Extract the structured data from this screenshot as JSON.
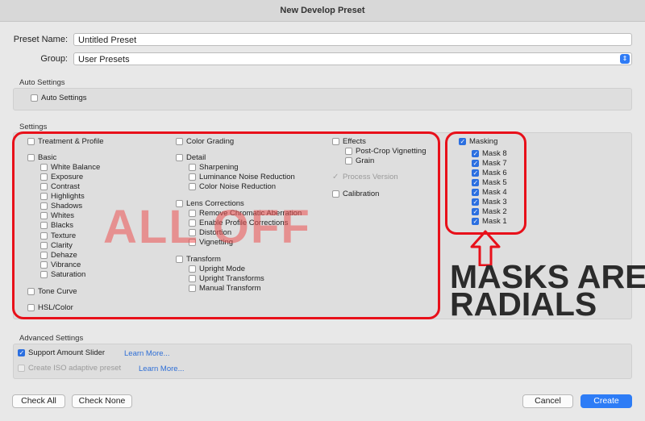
{
  "window": {
    "title": "New Develop Preset"
  },
  "preset_name": {
    "label": "Preset Name:",
    "value": "Untitled Preset"
  },
  "group": {
    "label": "Group:",
    "value": "User Presets"
  },
  "auto_settings": {
    "title": "Auto Settings",
    "checkbox_label": "Auto Settings"
  },
  "settings": {
    "title": "Settings",
    "col1": {
      "treatment": "Treatment & Profile",
      "basic": "Basic",
      "basic_items": [
        "White Balance",
        "Exposure",
        "Contrast",
        "Highlights",
        "Shadows",
        "Whites",
        "Blacks",
        "Texture",
        "Clarity",
        "Dehaze",
        "Vibrance",
        "Saturation"
      ],
      "tone_curve": "Tone Curve",
      "hsl": "HSL/Color"
    },
    "col2": {
      "color_grading": "Color Grading",
      "detail": "Detail",
      "detail_items": [
        "Sharpening",
        "Luminance Noise Reduction",
        "Color Noise Reduction"
      ],
      "lens": "Lens Corrections",
      "lens_items": [
        "Remove Chromatic Aberration",
        "Enable Profile Corrections",
        "Distortion",
        "Vignetting"
      ],
      "transform": "Transform",
      "transform_items": [
        "Upright Mode",
        "Upright Transforms",
        "Manual Transform"
      ]
    },
    "col3": {
      "effects": "Effects",
      "effects_items": [
        "Post-Crop Vignetting",
        "Grain"
      ],
      "process_version": "Process Version",
      "calibration": "Calibration"
    },
    "masking": {
      "label": "Masking",
      "checked": true,
      "items": [
        "Mask 8",
        "Mask 7",
        "Mask 6",
        "Mask 5",
        "Mask 4",
        "Mask 3",
        "Mask 2",
        "Mask 1"
      ]
    }
  },
  "annotations": {
    "all_off": "ALL OFF",
    "masks_line1": "MASKS ARE",
    "masks_line2": "RADIALS",
    "highlight_color": "#e8101a"
  },
  "advanced": {
    "title": "Advanced Settings",
    "support_amount_slider": "Support Amount Slider",
    "support_learn_more": "Learn More...",
    "iso_adaptive": "Create ISO adaptive preset",
    "iso_learn_more": "Learn More..."
  },
  "buttons": {
    "check_all": "Check All",
    "check_none": "Check None",
    "cancel": "Cancel",
    "create": "Create"
  }
}
